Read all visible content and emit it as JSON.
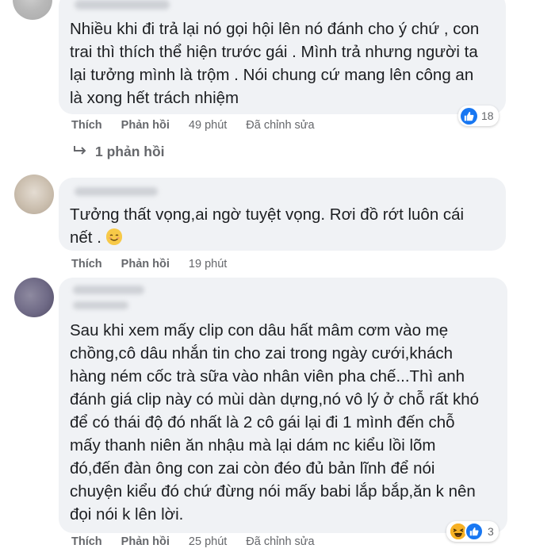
{
  "comments": [
    {
      "text": "Nhiều khi đi trả lại nó gọi hội lên nó đánh cho ý chứ , con\ntrai thì thích thể hiện trước gái . Mình trả nhưng người ta\nlại tưởng mình là trộm . Nói chung cứ mang lên công an\nlà xong hết trách nhiệm",
      "like": "Thích",
      "reply": "Phản hồi",
      "time": "49 phút",
      "edited": "Đã chỉnh sửa",
      "reaction_count": "18",
      "reply_link": "1 phản hồi"
    },
    {
      "text": "Tưởng thất vọng,ai ngờ tuyệt vọng. Rơi đồ rớt luôn cái\nnết .",
      "like": "Thích",
      "reply": "Phản hồi",
      "time": "19 phút"
    },
    {
      "text": "Sau khi xem mấy clip con dâu hất mâm cơm vào mẹ\nchồng,cô dâu nhắn tin cho zai trong ngày cưới,khách\nhàng ném cốc trà sữa vào nhân viên pha chế...Thì anh\nđánh giá clip này có mùi dàn dựng,nó vô lý ở chỗ rất khó\nđể có thái độ đó nhất là 2 cô gái lại đi 1 mình đến chỗ\nmấy thanh niên ăn nhậu mà lại dám nc kiểu lồi lõm\nđó,đến đàn ông con zai còn đéo đủ bản lĩnh để nói\nchuyện kiểu đó chứ đừng nói mấy babi lắp bắp,ăn k nên\nđọi nói k lên lời.",
      "like": "Thích",
      "reply": "Phản hồi",
      "time": "25 phút",
      "edited": "Đã chỉnh sửa",
      "reaction_count": "3"
    }
  ],
  "icons": {
    "reply_arrow": "reply-arrow-icon",
    "like": "like-reaction-icon",
    "haha": "haha-reaction-icon",
    "smile": "smiling-face-emoji"
  },
  "colors": {
    "bubble": "#f0f2f5",
    "meta": "#65676b",
    "like_blue": "#1877f2",
    "haha_yellow": "#f7b125"
  }
}
